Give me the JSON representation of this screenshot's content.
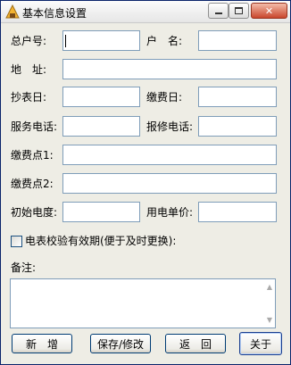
{
  "window": {
    "title": "基本信息设置",
    "close_glyph": "✕"
  },
  "form": {
    "account_no_label": "总户号:",
    "account_no_value": "",
    "household_name_label": "户　名:",
    "household_name_value": "",
    "address_label": "地　址:",
    "address_value": "",
    "meter_reading_day_label": "抄表日:",
    "meter_reading_day_value": "",
    "payment_day_label": "缴费日:",
    "payment_day_value": "",
    "service_phone_label": "服务电话:",
    "service_phone_value": "",
    "repair_phone_label": "报修电话:",
    "repair_phone_value": "",
    "payment_point1_label": "缴费点1:",
    "payment_point1_value": "",
    "payment_point2_label": "缴费点2:",
    "payment_point2_value": "",
    "initial_reading_label": "初始电度:",
    "initial_reading_value": "",
    "unit_price_label": "用电单价:",
    "unit_price_value": "",
    "meter_validity_label": "电表校验有效期(便于及时更换):",
    "meter_validity_checked": false,
    "remarks_label": "备注:",
    "remarks_value": ""
  },
  "buttons": {
    "add": "新　增",
    "save_edit": "保存/修改",
    "back": "返　回",
    "about": "关于"
  }
}
